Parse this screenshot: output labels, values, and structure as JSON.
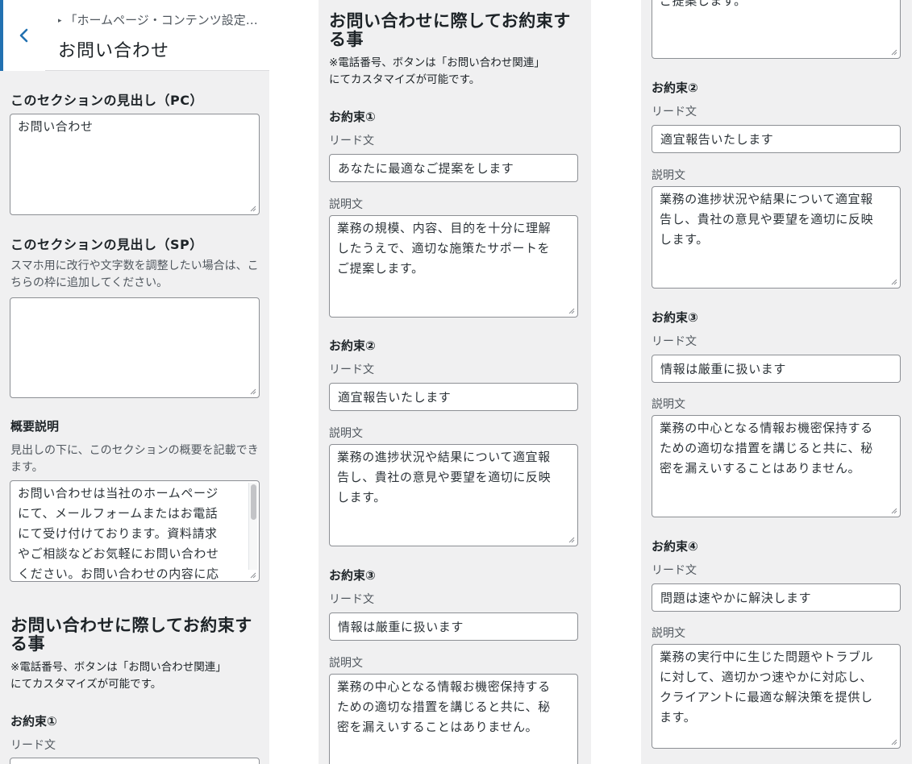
{
  "header": {
    "breadcrumb": "「ホームページ・コンテンツ設定…",
    "title": "お問い合わせ"
  },
  "heading_pc": {
    "label": "このセクションの見出し（PC）",
    "value": "お問い合わせ"
  },
  "heading_sp": {
    "label": "このセクションの見出し（SP）",
    "description": "スマホ用に改行や文字数を調整したい場合は、こちらの枠に追加してください。",
    "value": ""
  },
  "overview": {
    "label": "概要説明",
    "description": "見出しの下に、このセクションの概要を記載できます。",
    "lines": [
      "お問い合わせは当社のホームページ",
      "にて、メールフォームまたはお電話",
      "にて受け付けております。資料請求",
      "やご相談などお気軽にお問い合わせ",
      "ください。お問い合わせの内容に応"
    ]
  },
  "promises_section": {
    "title_line1": "お問い合わせに際してお約束す",
    "title_line2": "る事",
    "note_line1": "※電話番号、ボタンは「お問い合わせ関連」",
    "note_line2": "にてカスタマイズが可能です。"
  },
  "field_labels": {
    "lead": "リード文",
    "desc": "説明文"
  },
  "promises": [
    {
      "title": "お約束①",
      "lead": "あなたに最適なご提案をします",
      "desc_lines": [
        "業務の規模、内容、目的を十分に理解",
        "したうえで、適切な施策たサポートを",
        "ご提案します。"
      ]
    },
    {
      "title": "お約束②",
      "lead": "適宜報告いたします",
      "desc_lines": [
        "業務の進捗状況や結果について適宜報",
        "告し、貴社の意見や要望を適切に反映",
        "します。"
      ]
    },
    {
      "title": "お約束③",
      "lead": "情報は厳重に扱います",
      "desc_lines": [
        "業務の中心となる情報お機密保持する",
        "ための適切な措置を講じると共に、秘",
        "密を漏えいすることはありません。"
      ]
    },
    {
      "title": "お約束④",
      "lead": "問題は速やかに解決します",
      "desc_lines": [
        "業務の実行中に生じた問題やトラブル",
        "に対して、適切かつ速やかに対応し、",
        "クライアントに最適な解決策を提供し",
        "ます。"
      ]
    }
  ],
  "icons": {
    "back": "chevron-left-icon",
    "resize": "resize-grip-icon"
  },
  "colors": {
    "panel_bg": "#f0f0f1",
    "accent": "#2271b1",
    "field_border": "#8c8f94"
  }
}
